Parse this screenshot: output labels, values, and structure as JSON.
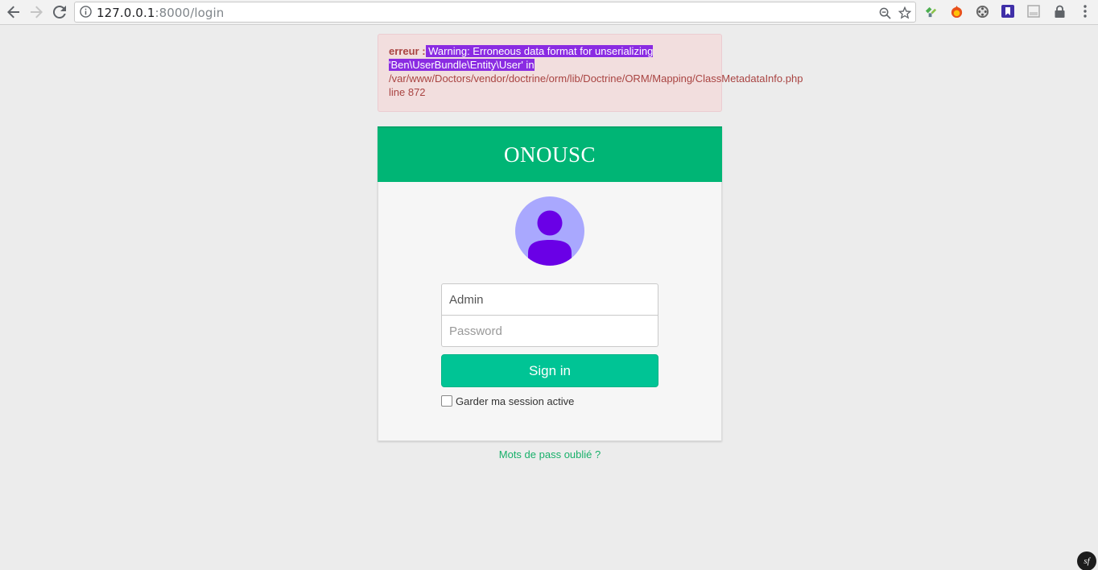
{
  "browser": {
    "url_host": "127.0.0.1",
    "url_rest": ":8000/login"
  },
  "alert": {
    "label": "erreur :",
    "message_highlighted_1": " Warning: Erroneous data format for unserializing ",
    "message_highlighted_2": "'Ben\\UserBundle\\Entity\\User' in",
    "path": "/var/www/Doctors/vendor/doctrine/orm/lib/Doctrine/ORM/Mapping/ClassMetadataInfo.php",
    "line": "line 872"
  },
  "login": {
    "title": "ONOUSC",
    "username_value": "Admin",
    "password_placeholder": "Password",
    "signin_label": "Sign in",
    "remember_label": "Garder ma session active",
    "forgot_label": "Mots de pass oublié ?"
  },
  "footer": {
    "symfony_badge": "sf"
  },
  "colors": {
    "header_green": "#00b575",
    "button_teal": "#00c495",
    "alert_bg": "#f2dede",
    "alert_text": "#a94442",
    "highlight": "#8a2be2",
    "avatar_bg": "#a9a8fe",
    "avatar_fg": "#6a00e6",
    "link_green": "#18b06a"
  },
  "icons": {
    "back": "arrow-left-icon",
    "forward": "arrow-right-icon",
    "reload": "reload-icon",
    "site_info": "info-icon",
    "zoom": "zoom-out-icon",
    "bookmark": "star-icon",
    "menu": "kebab-menu-icon",
    "avatar": "user-icon"
  }
}
